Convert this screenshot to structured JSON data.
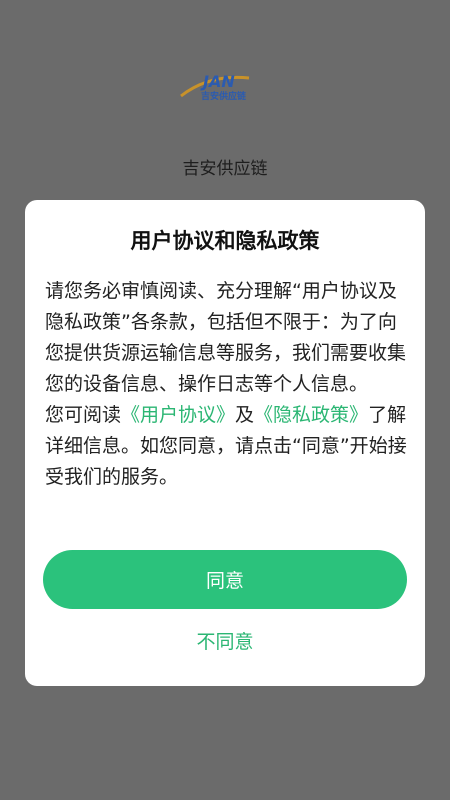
{
  "logo": {
    "text": "吉安供应链",
    "letters": "JAN",
    "icon": "jian-logo-icon",
    "colors": {
      "primary": "#2b5bb0",
      "accent": "#c8922a"
    }
  },
  "app_name": "吉安供应链",
  "dialog": {
    "title": "用户协议和隐私政策",
    "paragraph1": "请您务必审慎阅读、充分理解“用户协议及隐私政策”各条款，包括但不限于：为了向您提供货源运输信息等服务，我们需要收集您的设备信息、操作日志等个人信息。",
    "paragraph2_prefix": "您可阅读",
    "user_agreement_link": "《用户协议》",
    "and_text": "及",
    "privacy_policy_link": "《隐私政策》",
    "paragraph2_suffix": "了解详细信息。如您同意，请点击“同意”开始接受我们的服务。",
    "agree_label": "同意",
    "disagree_label": "不同意"
  },
  "colors": {
    "accent": "#2bc27c",
    "link": "#2bb673",
    "overlay": "#6b6b6b",
    "dialog_bg": "#ffffff"
  }
}
